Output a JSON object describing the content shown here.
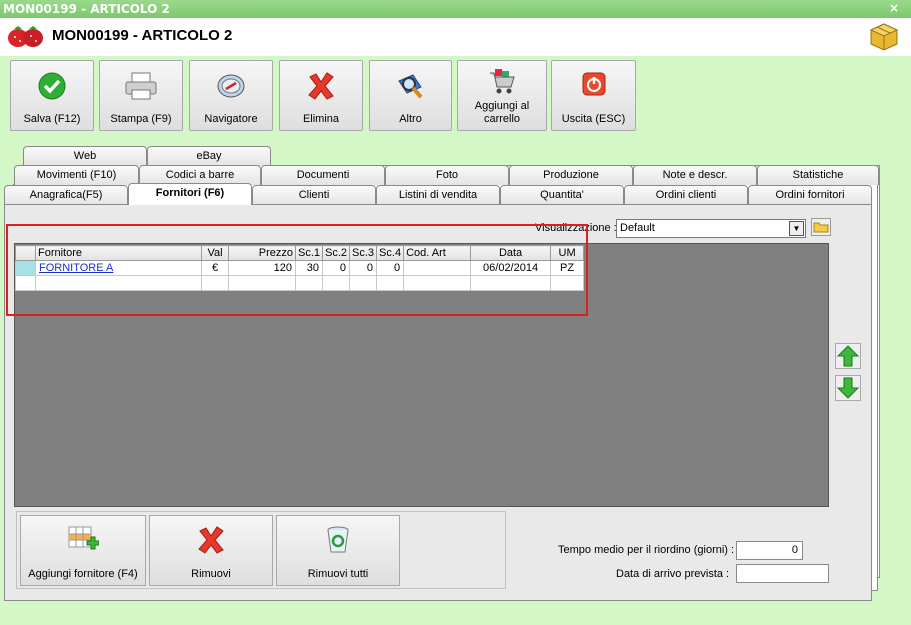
{
  "window": {
    "titlebar": "MON00199 - ARTICOLO 2",
    "close_glyph": "×",
    "header_title": "MON00199 - ARTICOLO 2"
  },
  "toolbar": [
    {
      "label": "Salva (F12)",
      "icon": "check-icon"
    },
    {
      "label": "Stampa (F9)",
      "icon": "printer-icon"
    },
    {
      "label": "Navigatore",
      "icon": "compass-icon"
    },
    {
      "label": "Elimina",
      "icon": "delete-x-icon"
    },
    {
      "label": "Altro",
      "icon": "magnifier-icon"
    },
    {
      "label": "Aggiungi al carrello",
      "icon": "cart-icon"
    },
    {
      "label": "Uscita (ESC)",
      "icon": "power-icon"
    }
  ],
  "tabs": {
    "row1": [
      "Web",
      "eBay"
    ],
    "row2": [
      "Movimenti (F10)",
      "Codici a barre",
      "Documenti",
      "Foto",
      "Produzione",
      "Note e descr.",
      "Statistiche"
    ],
    "row3": [
      "Anagrafica(F5)",
      "Fornitori (F6)",
      "Clienti",
      "Listini di vendita",
      "Quantita'",
      "Ordini clienti",
      "Ordini fornitori"
    ],
    "active": "Fornitori (F6)"
  },
  "view": {
    "label": "Visualizzazione :",
    "selected": "Default"
  },
  "grid": {
    "columns": [
      "Fornitore",
      "Val",
      "Prezzo",
      "Sc.1",
      "Sc.2",
      "Sc.3",
      "Sc.4",
      "Cod. Art",
      "Data",
      "UM"
    ],
    "rows": [
      {
        "fornitore": "FORNITORE A",
        "val": "€",
        "prezzo": "120",
        "sc1": "30",
        "sc2": "0",
        "sc3": "0",
        "sc4": "0",
        "cod_art": "",
        "data": "06/02/2014",
        "um": "PZ"
      }
    ]
  },
  "bottom_buttons": [
    {
      "label": "Aggiungi fornitore (F4)",
      "icon": "add-grid-icon"
    },
    {
      "label": "Rimuovi",
      "icon": "delete-x-icon"
    },
    {
      "label": "Rimuovi tutti",
      "icon": "recycle-bin-icon"
    }
  ],
  "fields": {
    "tempo_label": "Tempo medio per il riordino (giorni) :",
    "tempo_value": "0",
    "data_arrivo_label": "Data di arrivo prevista :",
    "data_arrivo_value": ""
  }
}
